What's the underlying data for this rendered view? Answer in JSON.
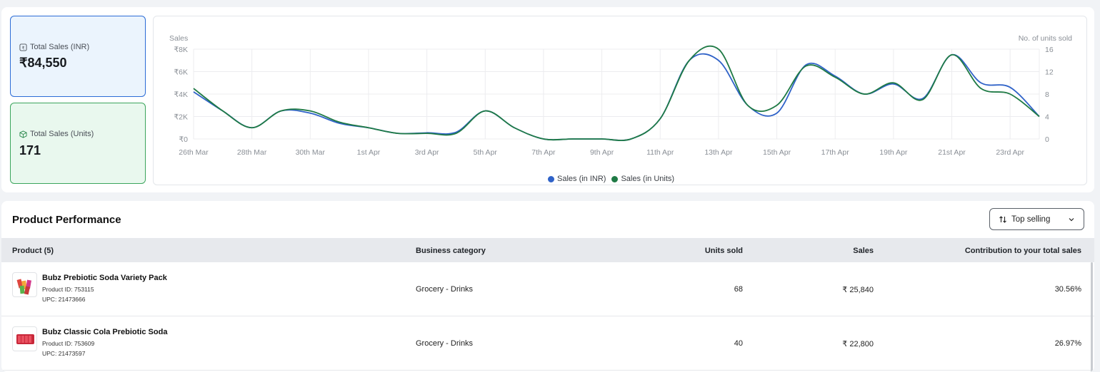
{
  "stats": {
    "inr": {
      "label": "Total Sales (INR)",
      "value": "₹84,550"
    },
    "units": {
      "label": "Total Sales (Units)",
      "value": "171"
    }
  },
  "chart_data": {
    "type": "line",
    "y_left_label": "Sales",
    "y_right_label": "No. of units sold",
    "y_left_ticks": [
      "₹8K",
      "₹6K",
      "₹4K",
      "₹2K",
      "₹0"
    ],
    "y_right_ticks": [
      "16",
      "12",
      "8",
      "4",
      "0"
    ],
    "ylim_left": [
      0,
      8000
    ],
    "ylim_right": [
      0,
      16
    ],
    "x_tick_labels": [
      "26th Mar",
      "28th Mar",
      "30th Mar",
      "1st Apr",
      "3rd Apr",
      "5th Apr",
      "7th Apr",
      "9th Apr",
      "11th Apr",
      "13th Apr",
      "15th Apr",
      "17th Apr",
      "19th Apr",
      "21st Apr",
      "23rd Apr"
    ],
    "x": [
      "26th Mar",
      "27th Mar",
      "28th Mar",
      "29th Mar",
      "30th Mar",
      "31st Mar",
      "1st Apr",
      "2nd Apr",
      "3rd Apr",
      "4th Apr",
      "5th Apr",
      "6th Apr",
      "7th Apr",
      "8th Apr",
      "9th Apr",
      "10th Apr",
      "11th Apr",
      "12th Apr",
      "13th Apr",
      "14th Apr",
      "15th Apr",
      "16th Apr",
      "17th Apr",
      "18th Apr",
      "19th Apr",
      "20th Apr",
      "21st Apr",
      "22nd Apr",
      "23rd Apr",
      "24th Apr"
    ],
    "series": [
      {
        "name": "Sales (in INR)",
        "color": "#2f62c8",
        "axis": "left",
        "values": [
          4200,
          2500,
          1000,
          2500,
          2300,
          1400,
          1000,
          500,
          550,
          600,
          2500,
          1000,
          0,
          0,
          0,
          0,
          1800,
          7000,
          7000,
          3000,
          2300,
          6600,
          5600,
          4000,
          4900,
          3600,
          7500,
          5000,
          4600,
          2000
        ]
      },
      {
        "name": "Sales (in Units)",
        "color": "#1f7a45",
        "axis": "right",
        "values": [
          9,
          5,
          2,
          5,
          5,
          3,
          2,
          1,
          1,
          1,
          5,
          2,
          0,
          0,
          0,
          0,
          3.6,
          14,
          16,
          6,
          6,
          13,
          11,
          8,
          10,
          7,
          15,
          9,
          8,
          4
        ]
      }
    ],
    "legend_position": "bottom-center",
    "grid": true
  },
  "performance": {
    "title": "Product Performance",
    "sort_label": "Top selling",
    "columns": {
      "product": "Product (5)",
      "category": "Business category",
      "units": "Units sold",
      "sales": "Sales",
      "contribution": "Contribution to your total sales"
    },
    "rows": [
      {
        "name": "Bubz Prebiotic Soda Variety Pack",
        "product_id": "Product ID: 753115",
        "upc": "UPC: 21473666",
        "category": "Grocery - Drinks",
        "units": "68",
        "sales": "₹ 25,840",
        "contribution": "30.56%"
      },
      {
        "name": "Bubz Classic Cola Prebiotic Soda",
        "product_id": "Product ID: 753609",
        "upc": "UPC: 21473597",
        "category": "Grocery - Drinks",
        "units": "40",
        "sales": "₹ 22,800",
        "contribution": "26.97%"
      }
    ]
  }
}
